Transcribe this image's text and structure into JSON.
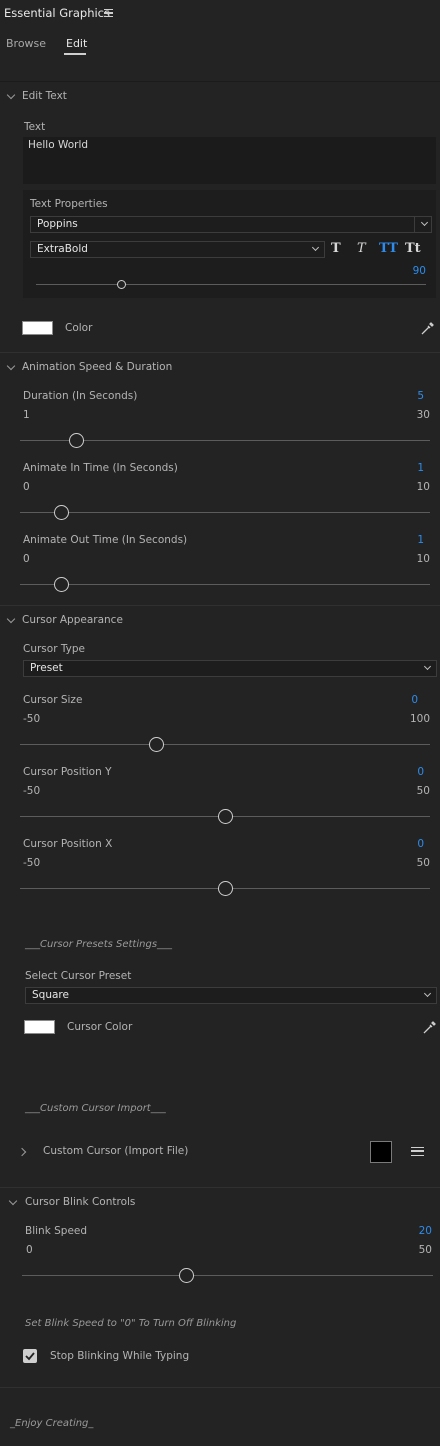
{
  "panel": {
    "title": "Essential Graphics",
    "menu_icon": "hamburger-icon"
  },
  "tabs": [
    {
      "label": "Browse",
      "active": false
    },
    {
      "label": "Edit",
      "active": true
    }
  ],
  "edit_text": {
    "header": "Edit Text",
    "text_label": "Text",
    "text_value": "Hello World",
    "text_properties": {
      "label": "Text Properties",
      "font_family": "Poppins",
      "font_style": "ExtraBold",
      "style_buttons": [
        "T",
        "T",
        "TT",
        "Tt"
      ],
      "size_value": "90",
      "size_fraction": 0.22
    },
    "color_label": "Color",
    "color": "#ffffff"
  },
  "animation": {
    "header": "Animation Speed & Duration",
    "sliders": [
      {
        "label": "Duration (In Seconds)",
        "value": "5",
        "min": "1",
        "max": "30",
        "fraction": 0.138
      },
      {
        "label": "Animate In Time (In Seconds)",
        "value": "1",
        "min": "0",
        "max": "10",
        "fraction": 0.1
      },
      {
        "label": "Animate Out Time (In Seconds)",
        "value": "1",
        "min": "0",
        "max": "10",
        "fraction": 0.1
      }
    ]
  },
  "cursor_appearance": {
    "header": "Cursor Appearance",
    "cursor_type_label": "Cursor Type",
    "cursor_type_value": "Preset",
    "sliders": [
      {
        "label": "Cursor Size",
        "value": "0",
        "min": "-50",
        "max": "100",
        "fraction": 0.333
      },
      {
        "label": "Cursor Position Y",
        "value": "0",
        "min": "-50",
        "max": "50",
        "fraction": 0.5
      },
      {
        "label": "Cursor Position X",
        "value": "0",
        "min": "-50",
        "max": "50",
        "fraction": 0.5
      }
    ],
    "presets_heading": "___Cursor Presets Settings___",
    "select_preset_label": "Select Cursor Preset",
    "select_preset_value": "Square",
    "cursor_color_label": "Cursor Color",
    "cursor_color": "#ffffff",
    "custom_import_heading": "___Custom Cursor Import___",
    "custom_cursor_label": "Custom Cursor (Import File)",
    "custom_cursor_swatch": "#000000"
  },
  "blink": {
    "header": "Cursor Blink Controls",
    "slider": {
      "label": "Blink Speed",
      "value": "20",
      "min": "0",
      "max": "50",
      "fraction": 0.4
    },
    "hint": "Set Blink Speed to \"0\" To Turn Off Blinking",
    "checkbox_label": "Stop Blinking While Typing",
    "checkbox_checked": true
  },
  "footer": "_Enjoy Creating_",
  "colors": {
    "accent": "#2d8ceb",
    "background": "#232323"
  }
}
